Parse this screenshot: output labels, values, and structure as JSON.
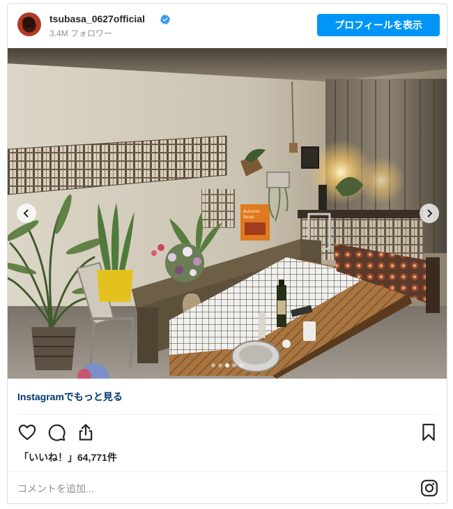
{
  "header": {
    "username": "tsubasa_0627official",
    "followers": "3.4M フォロワー",
    "profile_button": "プロフィールを表示"
  },
  "photo": {
    "carousel_count": 5,
    "carousel_active_index": 2,
    "poster_line1": "Autumn",
    "poster_line2": "Soup"
  },
  "more_link": "Instagramでもっと見る",
  "likes": "「いいね！」64,771件",
  "comment": {
    "placeholder": "コメントを追加..."
  },
  "icons": [
    "heart-icon",
    "comment-icon",
    "share-icon",
    "bookmark-icon",
    "instagram-icon",
    "verified-icon",
    "chevron-left-icon",
    "chevron-right-icon"
  ],
  "colors": {
    "accent": "#0095f6",
    "link": "#00376b",
    "text": "#262626",
    "muted": "#8e8e8e"
  }
}
